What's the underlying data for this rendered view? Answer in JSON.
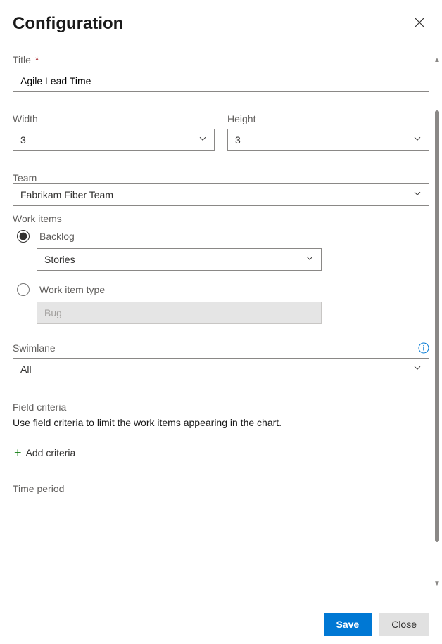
{
  "header": {
    "title": "Configuration"
  },
  "fields": {
    "title": {
      "label": "Title",
      "required_marker": "*",
      "value": "Agile Lead Time"
    },
    "width": {
      "label": "Width",
      "value": "3"
    },
    "height": {
      "label": "Height",
      "value": "3"
    },
    "team": {
      "label": "Team",
      "value": "Fabrikam Fiber Team"
    },
    "workitems": {
      "label": "Work items",
      "backlog": {
        "label": "Backlog",
        "value": "Stories"
      },
      "workitemtype": {
        "label": "Work item type",
        "value": "Bug"
      }
    },
    "swimlane": {
      "label": "Swimlane",
      "value": "All"
    },
    "fieldcriteria": {
      "label": "Field criteria",
      "helper": "Use field criteria to limit the work items appearing in the chart.",
      "add_label": "Add criteria"
    },
    "timeperiod": {
      "label": "Time period"
    }
  },
  "footer": {
    "save": "Save",
    "close": "Close"
  }
}
